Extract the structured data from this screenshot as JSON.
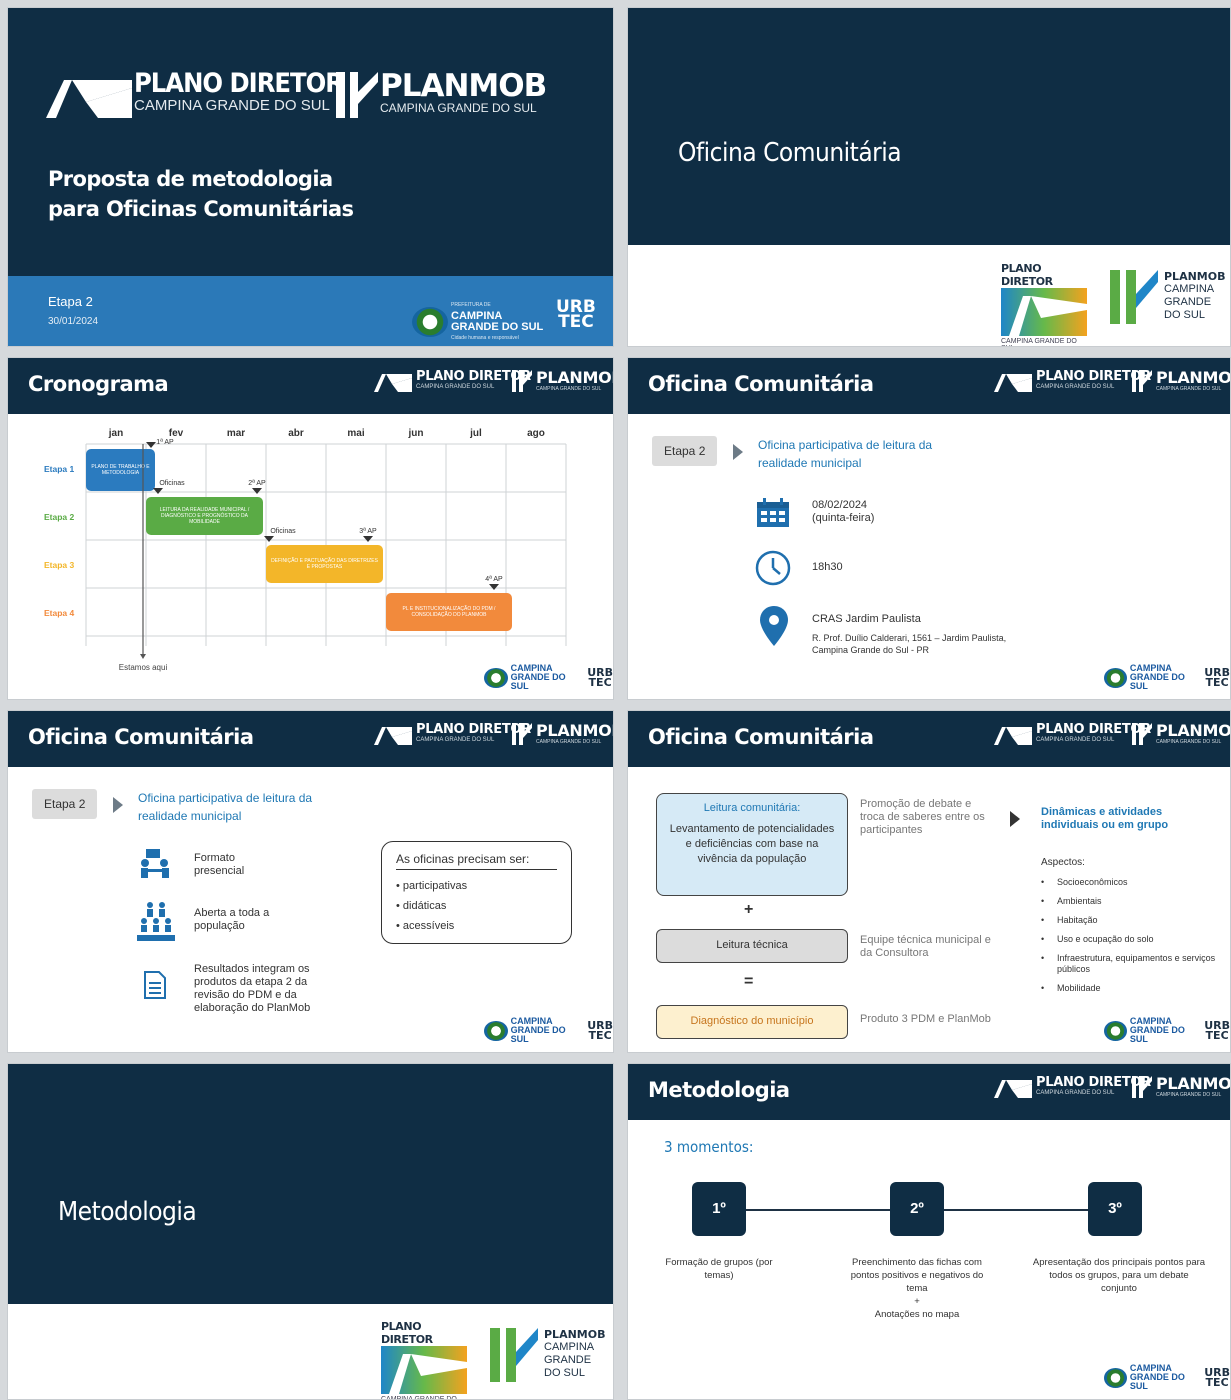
{
  "logos": {
    "plano_diretor": "PLANO DIRETOR",
    "campina": "CAMPINA GRANDE DO SUL",
    "planmob": "PLANMOB",
    "urb": "URB",
    "tec": "TEC",
    "muni_top": "PREFEITURA DE",
    "muni_name1": "CAMPINA",
    "muni_name2": "GRANDE DO SUL",
    "muni_tag": "Cidade humana e responsável",
    "planmob_stack": [
      "CAMPINA",
      "GRANDE",
      "DO SUL"
    ]
  },
  "s1": {
    "title1": "Proposta de metodologia",
    "title2": "para Oficinas Comunitárias",
    "etapa": "Etapa 2",
    "date": "30/01/2024"
  },
  "s2": {
    "title": "Oficina Comunitária"
  },
  "s3": {
    "title": "Cronograma",
    "months": [
      "jan",
      "fev",
      "mar",
      "abr",
      "mai",
      "jun",
      "jul",
      "ago"
    ],
    "stages": [
      "Etapa 1",
      "Etapa 2",
      "Etapa 3",
      "Etapa 4"
    ],
    "bars": [
      {
        "text": "PLANO DE TRABALHO E METODOLOGIA",
        "color": "#2b7bbf"
      },
      {
        "text": "LEITURA DA REALIDADE MUNICIPAL / DIAGNÓSTICO E PROGNÓSTICO DA MOBILIDADE",
        "color": "#5aab45"
      },
      {
        "text": "DEFINIÇÃO E PACTUAÇÃO DAS DIRETRIZES E PROPOSTAS",
        "color": "#f3b629"
      },
      {
        "text": "PL E INSTITUCIONALIZAÇÃO DO PDM / CONSOLIDAÇÃO DO PLANMOB",
        "color": "#f28a3c"
      }
    ],
    "markers": [
      "1ª AP",
      "2ª AP",
      "3ª AP",
      "4ª AP"
    ],
    "oficinas": "Oficinas",
    "here": "Estamos aqui"
  },
  "s4": {
    "title": "Oficina Comunitária",
    "etapa": "Etapa 2",
    "desc": "Oficina participativa de leitura da realidade municipal",
    "date": "08/02/2024",
    "weekday": "(quinta-feira)",
    "time": "18h30",
    "place": "CRAS Jardim Paulista",
    "addr1": "R. Prof. Duílio Calderari, 1561 – Jardim Paulista,",
    "addr2": "Campina Grande do Sul - PR"
  },
  "s5": {
    "title": "Oficina Comunitária",
    "etapa": "Etapa 2",
    "desc": "Oficina participativa de leitura da realidade municipal",
    "i1a": "Formato",
    "i1b": "presencial",
    "i2a": "Aberta a toda a",
    "i2b": "população",
    "i3": [
      "Resultados integram os",
      "produtos da etapa 2 da",
      "revisão do PDM e da",
      "elaboração do PlanMob"
    ],
    "box_title": "As oficinas precisam ser:",
    "box_items": [
      "participativas",
      "didáticas",
      "acessíveis"
    ]
  },
  "s6": {
    "title": "Oficina Comunitária",
    "b1_title": "Leitura comunitária:",
    "b1_text": "Levantamento de potencialidades e deficiências com base na vivência da população",
    "plus": "+",
    "b2": "Leitura técnica",
    "eq": "=",
    "b3": "Diagnóstico do município",
    "n1": "Promoção de debate e troca de saberes entre os participantes",
    "n2": "Equipe técnica municipal e da Consultora",
    "n3": "Produto 3 PDM e PlanMob",
    "din": "Dinâmicas e atividades individuais ou em grupo",
    "asp": "Aspectos:",
    "aspects": [
      "Socioeconômicos",
      "Ambientais",
      "Habitação",
      "Uso e ocupação do solo",
      "Infraestrutura, equipamentos e serviços públicos",
      "Mobilidade"
    ]
  },
  "s7": {
    "title": "Metodologia"
  },
  "s8": {
    "title": "Metodologia",
    "sub": "3 momentos:",
    "steps": [
      "1º",
      "2º",
      "3º"
    ],
    "d1": "Formação de grupos (por temas)",
    "d2": "Preenchimento das fichas com pontos positivos e negativos do tema",
    "d2plus": "+",
    "d2b": "Anotações no mapa",
    "d3": "Apresentação dos principais pontos para todos os grupos, para um debate conjunto"
  },
  "colors": {
    "navy": "#0f2d44",
    "blue_band": "#2b79b8",
    "accent": "#1f78b4"
  }
}
